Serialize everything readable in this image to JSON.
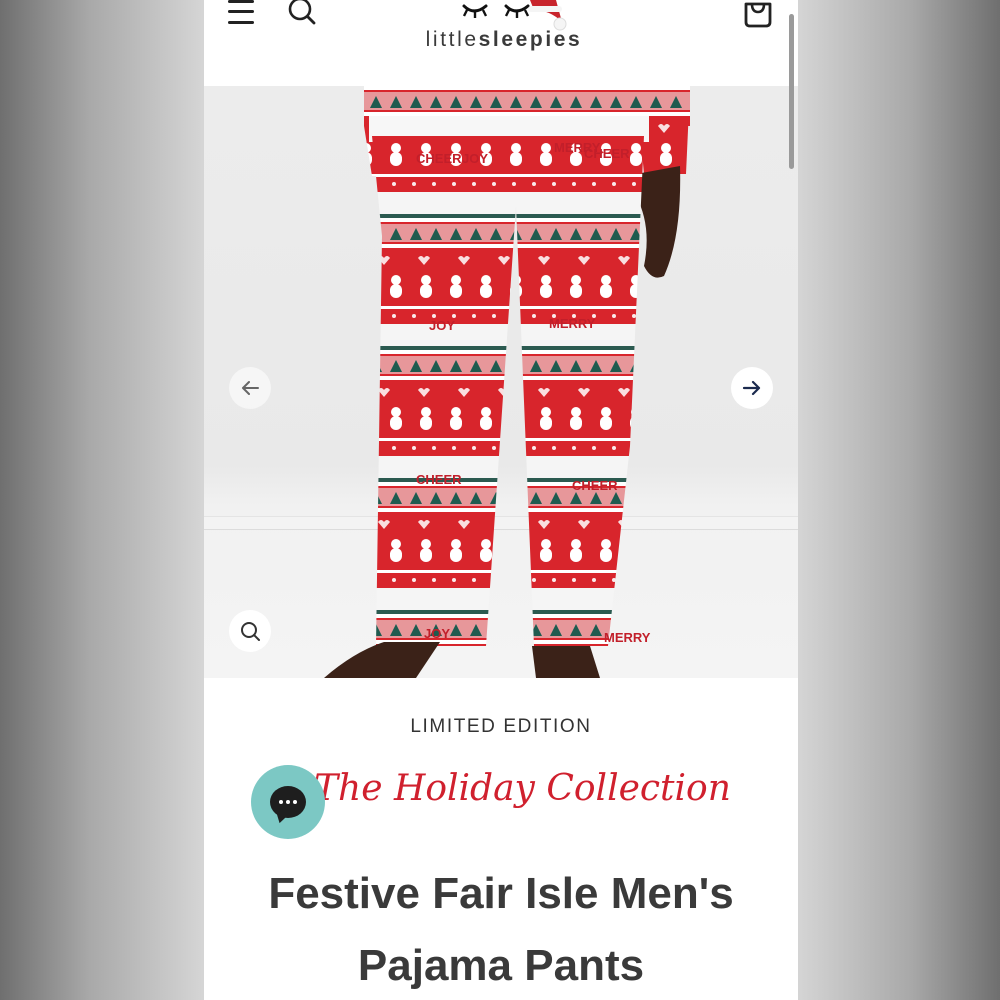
{
  "header": {
    "brand_light": "little",
    "brand_bold": "sleepies",
    "icons": [
      "menu-icon",
      "search-icon",
      "cart-icon",
      "logo-eyes-icon"
    ]
  },
  "gallery": {
    "prev_icon": "arrow-left-icon",
    "next_icon": "arrow-right-icon",
    "zoom_icon": "zoom-icon",
    "pants_print_text": [
      "CHEER",
      "JOY",
      "MERRY",
      "CHEER",
      "JOY",
      "MERRY",
      "CHEER"
    ]
  },
  "product": {
    "eyebrow": "LIMITED EDITION",
    "collection": "The Holiday Collection",
    "title_line1": "Festive Fair Isle Men's",
    "title_line2": "Pajama Pants"
  },
  "chat": {
    "icon": "chat-icon"
  },
  "colors": {
    "accent_red": "#d0202e",
    "teal": "#7cc8c4",
    "text_dark": "#3a3a3a"
  }
}
